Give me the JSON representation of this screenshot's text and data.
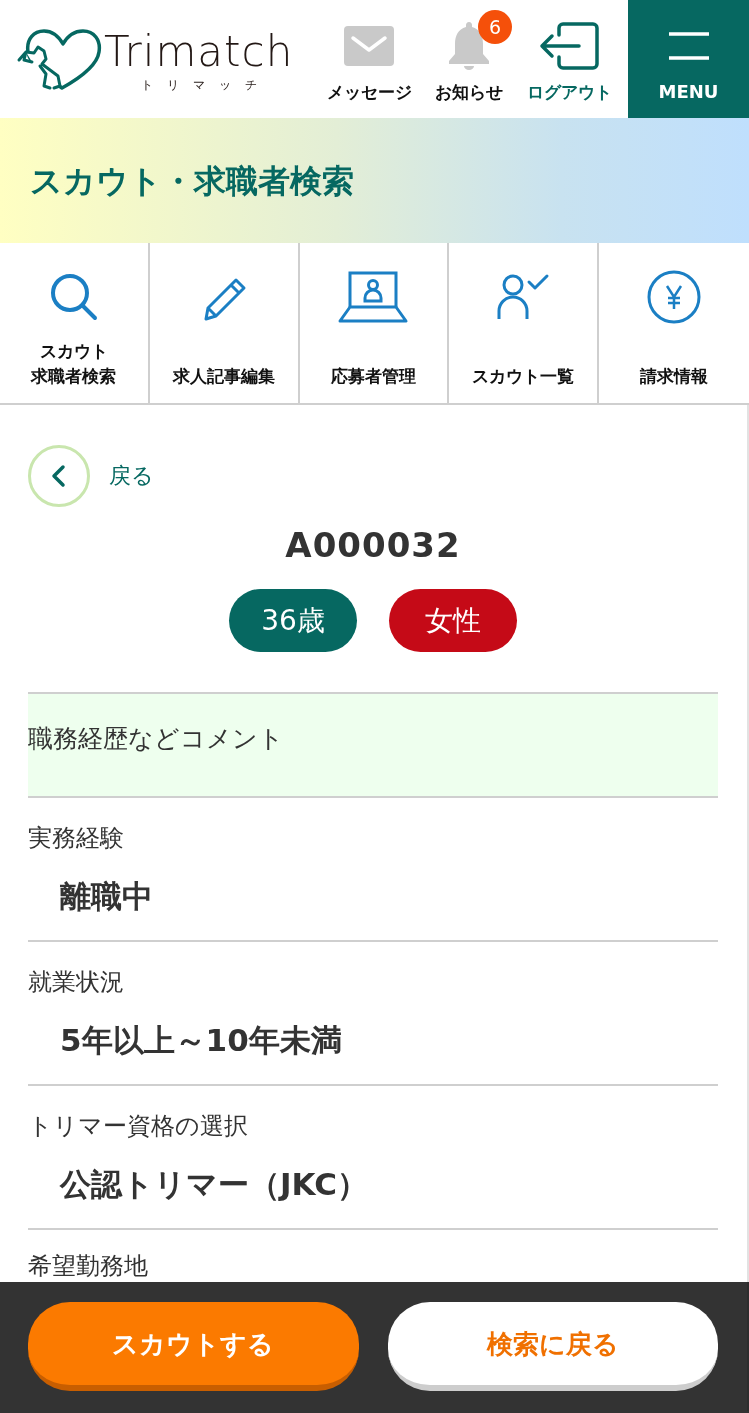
{
  "header": {
    "logo": {
      "name": "Trimatch",
      "kana": "トリマッチ"
    },
    "links": [
      {
        "kind": "message",
        "label": "メッセージ"
      },
      {
        "kind": "notification",
        "label": "お知らせ",
        "badge": "6"
      },
      {
        "kind": "logout",
        "label": "ログアウト"
      }
    ],
    "menu_button": {
      "label": "MENU"
    }
  },
  "page_title": "スカウト・求職者検索",
  "nav": [
    {
      "kind": "search",
      "label": "スカウト求職者検索"
    },
    {
      "kind": "edit",
      "label": "求人記事編集"
    },
    {
      "kind": "applicants",
      "label": "応募者管理"
    },
    {
      "kind": "scout_list",
      "label": "スカウト一覧"
    },
    {
      "kind": "billing",
      "label": "請求情報"
    }
  ],
  "back_link": {
    "label": "戻る"
  },
  "candidate": {
    "id": "A000032",
    "tags": [
      {
        "label": "36歳",
        "color": "#066861"
      },
      {
        "label": "女性",
        "color": "#c50a17"
      }
    ]
  },
  "comment": {
    "label": "職務経歴などコメント"
  },
  "fields": [
    {
      "label": "実務経験",
      "value": "離職中"
    },
    {
      "label": "就業状況",
      "value": "5年以上～10年未満"
    },
    {
      "label": "トリマー資格の選択",
      "value": "公認トリマー（JKC）"
    },
    {
      "label": "希望勤務地"
    }
  ],
  "actions": [
    {
      "kind": "primary",
      "label": "スカウトする"
    },
    {
      "kind": "secondary",
      "label": "検索に戻る"
    }
  ]
}
